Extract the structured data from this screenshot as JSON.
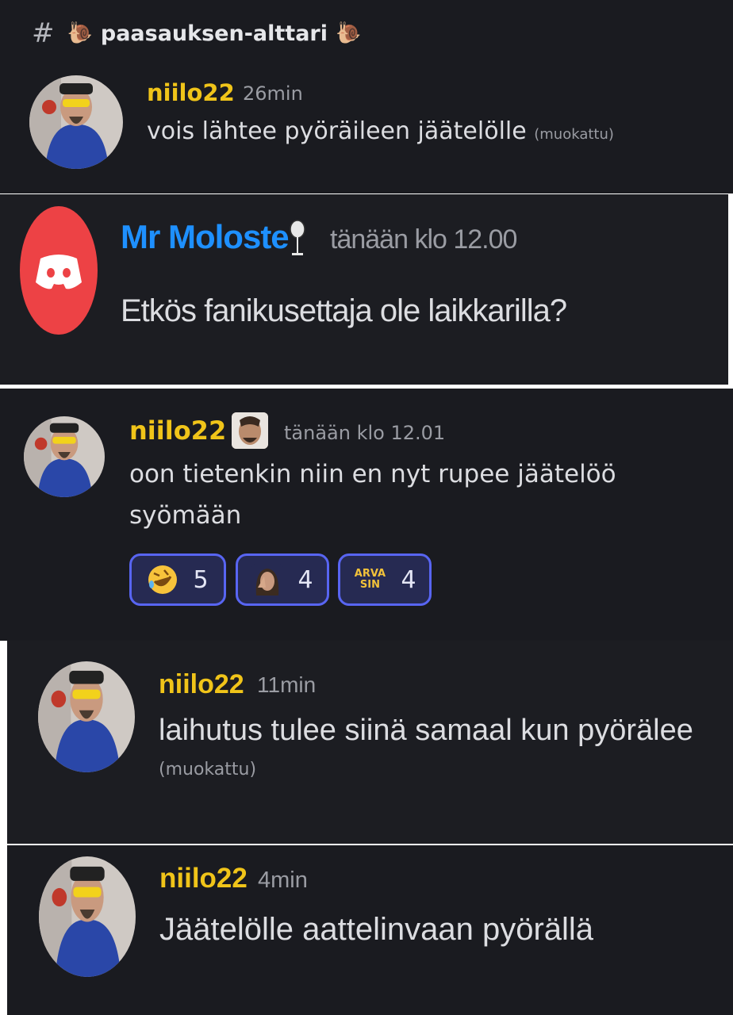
{
  "channel": {
    "hash": "#",
    "emoji": "🐌",
    "name": "paasauksen-alttari"
  },
  "colors": {
    "username_gold": "#f0c419",
    "username_blue": "#1e90ff",
    "discord_red": "#ed4245",
    "reaction_border": "#5865f2"
  },
  "messages": [
    {
      "author": "niilo22",
      "time": "26min",
      "text": "vois lähtee pyöräileen jäätelölle",
      "edited": "(muokattu)"
    },
    {
      "author": "Mr Moloste",
      "time": "tänään klo 12.00",
      "text": "Etkös fanikusettaja ole laikkarilla?",
      "badge_icon": "wineglass-icon"
    },
    {
      "author": "niilo22",
      "time": "tänään klo 12.01",
      "text_line1": "oon tietenkin niin en nyt rupee jäätelöö",
      "text_line2": "syömään",
      "reactions": [
        {
          "icon": "rofl-emoji-icon",
          "count": "5"
        },
        {
          "icon": "face-palm-emote-icon",
          "count": "4"
        },
        {
          "icon": "arva-sin-emote-icon",
          "label_line1": "ARVA",
          "label_line2": "SIN",
          "count": "4"
        }
      ]
    },
    {
      "author": "niilo22",
      "time": "11min",
      "text": "laihutus tulee siinä samaal kun pyörälee",
      "edited": "(muokattu)"
    },
    {
      "author": "niilo22",
      "time": "4min",
      "text": "Jäätelölle aattelinvaan pyörällä"
    }
  ]
}
